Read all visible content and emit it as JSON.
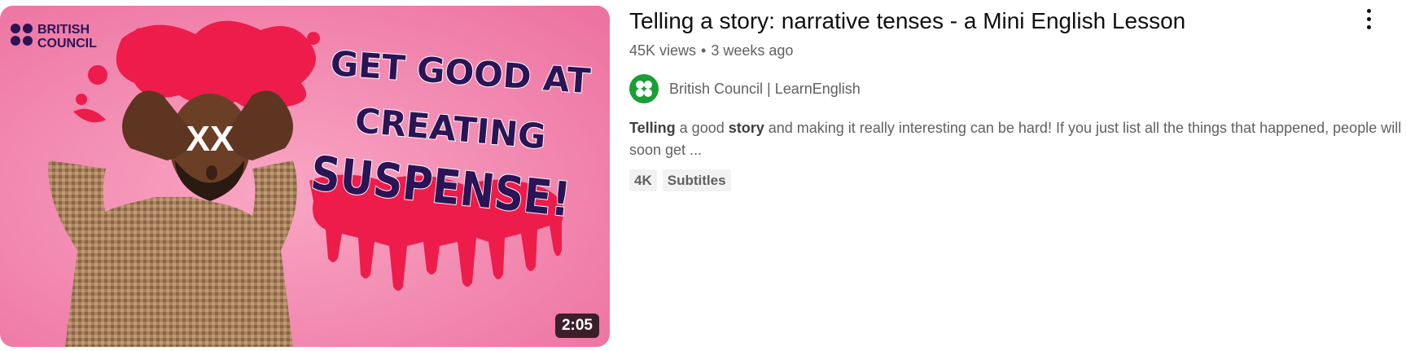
{
  "video": {
    "title": "Telling a story: narrative tenses - a Mini English Lesson",
    "views": "45K views",
    "separator": "•",
    "age": "3 weeks ago",
    "duration": "2:05"
  },
  "thumbnail": {
    "brand_line1": "BRITISH",
    "brand_line2": "COUNCIL",
    "text_line1": "GET GOOD AT",
    "text_line2": "CREATING",
    "text_line3": "SUSPENSE!",
    "eye_marks": "XX",
    "background_color": "#f07aa8",
    "splash_color": "#ee1c4b",
    "text_color": "#2b1456"
  },
  "channel": {
    "name": "British Council | LearnEnglish",
    "avatar_icon": "british-council-logo-icon",
    "avatar_color": "#1a9e35"
  },
  "description": {
    "bold1": "Telling",
    "text1": " a good ",
    "bold2": "story",
    "text2": " and making it really interesting can be hard! If you just list all the things that happened, people will soon get ..."
  },
  "badges": [
    "4K",
    "Subtitles"
  ],
  "menu": {
    "icon": "more-vert-icon"
  }
}
